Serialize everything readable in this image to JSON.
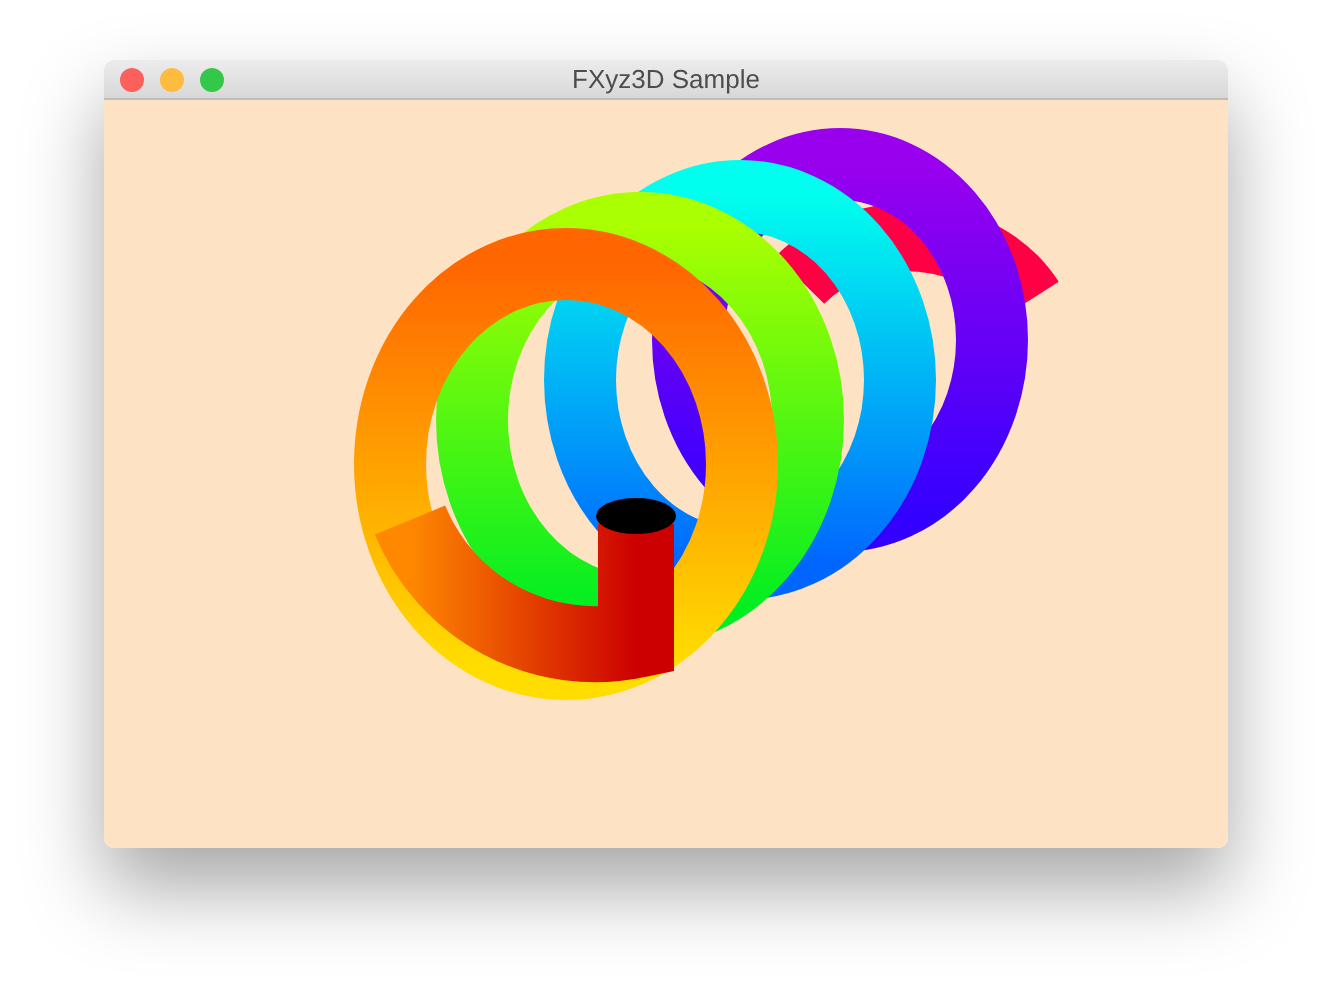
{
  "window": {
    "title": "FXyz3D Sample"
  }
}
